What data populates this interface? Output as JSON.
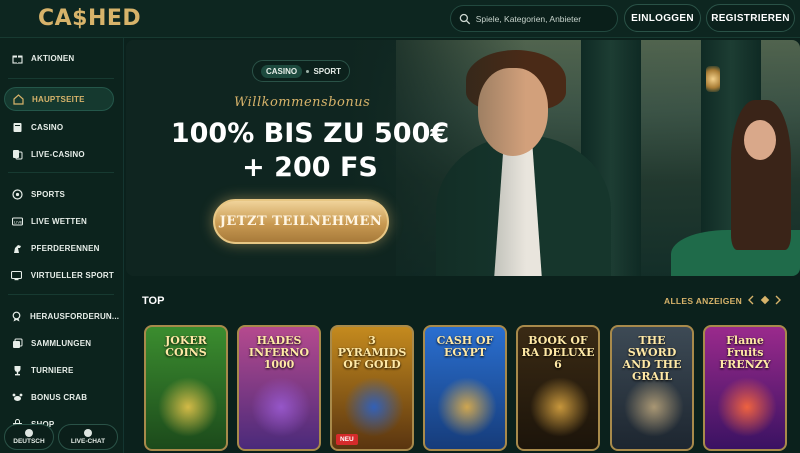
{
  "header": {
    "logo": "CA$HED",
    "search_placeholder": "Spiele, Kategorien, Anbieter",
    "login_label": "EINLOGGEN",
    "register_label": "REGISTRIEREN"
  },
  "sidebar": {
    "items": [
      {
        "label": "AKTIONEN",
        "icon": "gift-icon"
      },
      {
        "label": "HAUPTSEITE",
        "icon": "home-icon",
        "active": true
      },
      {
        "label": "CASINO",
        "icon": "cards-icon"
      },
      {
        "label": "LIVE-CASINO",
        "icon": "live-cards-icon"
      },
      {
        "label": "SPORTS",
        "icon": "ball-icon"
      },
      {
        "label": "LIVE WETTEN",
        "icon": "live-tv-icon"
      },
      {
        "label": "PFERDERENNEN",
        "icon": "horse-icon"
      },
      {
        "label": "VIRTUELLER SPORT",
        "icon": "monitor-icon"
      },
      {
        "label": "HERAUSFORDERUN...",
        "icon": "medal-icon"
      },
      {
        "label": "SAMMLUNGEN",
        "icon": "collection-icon"
      },
      {
        "label": "TURNIERE",
        "icon": "trophy-icon"
      },
      {
        "label": "BONUS CRAB",
        "icon": "crab-icon"
      },
      {
        "label": "SHOP",
        "icon": "shop-icon"
      }
    ],
    "language_label": "DEUTSCH",
    "chat_label": "LIVE-CHAT"
  },
  "hero": {
    "tab_casino": "CASINO",
    "tab_sport": "SPORT",
    "bonus_script": "Willkommensbonus",
    "headline_line1": "100% BIS ZU 500€",
    "headline_line2": "+ 200 FS",
    "cta_label": "JETZT TEILNEHMEN"
  },
  "top": {
    "title": "TOP",
    "show_all": "ALLES ANZEIGEN",
    "games": [
      {
        "name": "JOKER COINS",
        "colors": [
          "#3b8d2f",
          "#1c4a1b"
        ],
        "art": "#e6c44b"
      },
      {
        "name": "HADES INFERNO 1000",
        "colors": [
          "#b54a8e",
          "#4a2a7a"
        ],
        "art": "#9a5ad1"
      },
      {
        "name": "3 PYRAMIDS OF GOLD",
        "colors": [
          "#c48a1e",
          "#5a3510"
        ],
        "art": "#2a62c9",
        "badge": "NEU"
      },
      {
        "name": "CASH OF EGYPT",
        "colors": [
          "#2a6fd0",
          "#163c7a"
        ],
        "art": "#e3b048"
      },
      {
        "name": "BOOK OF RA DELUXE 6",
        "colors": [
          "#3a2a14",
          "#1c140a"
        ],
        "art": "#d9a441"
      },
      {
        "name": "THE SWORD AND THE GRAIL",
        "colors": [
          "#3d4a55",
          "#1d2630"
        ],
        "art": "#b7a27a"
      },
      {
        "name": "Flame Fruits FRENZY",
        "colors": [
          "#9a2a8c",
          "#3a1262"
        ],
        "art": "#ff6a3a"
      }
    ]
  },
  "colors": {
    "accent_gold": "#d7b36a",
    "bg_dark": "#0b211c"
  }
}
